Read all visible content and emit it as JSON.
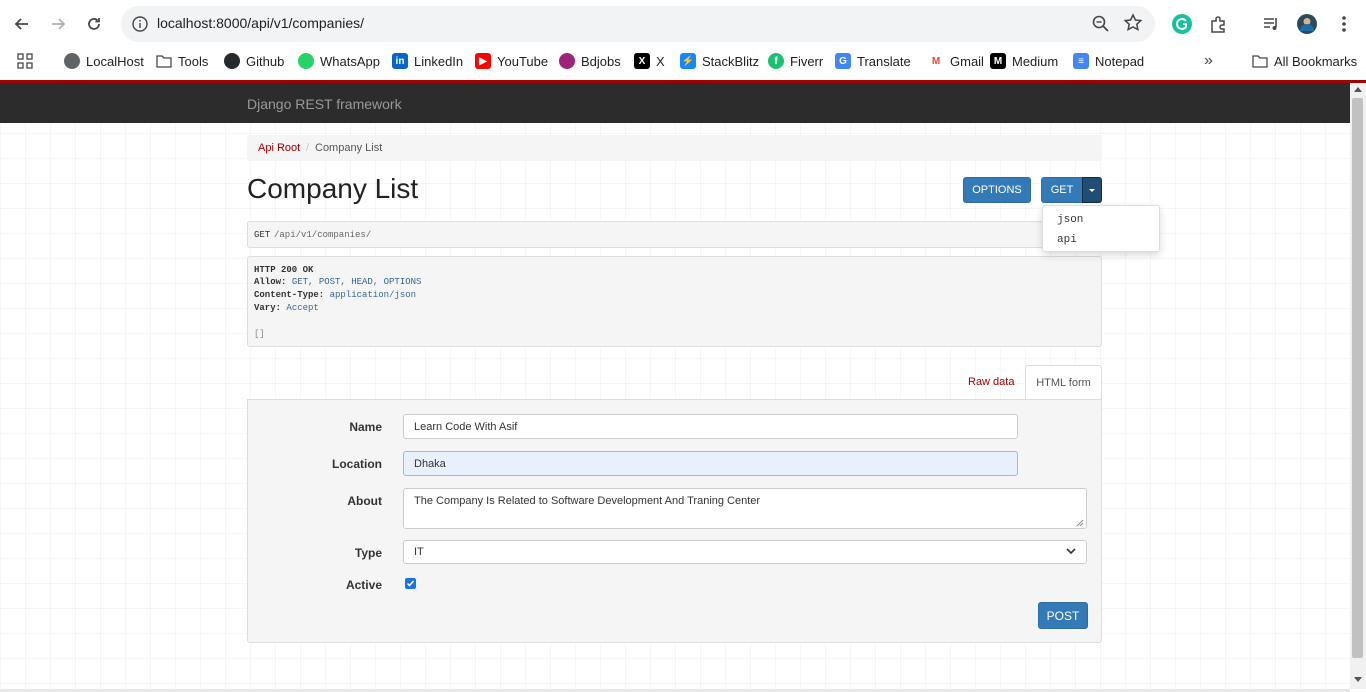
{
  "browser": {
    "url": "localhost:8000/api/v1/companies/",
    "bookmarks": [
      {
        "label": "LocalHost",
        "icon": "globe-icon"
      },
      {
        "label": "Tools",
        "icon": "folder-icon"
      },
      {
        "label": "Github",
        "icon": "github-icon"
      },
      {
        "label": "WhatsApp",
        "icon": "whatsapp-icon"
      },
      {
        "label": "LinkedIn",
        "icon": "linkedin-icon"
      },
      {
        "label": "YouTube",
        "icon": "youtube-icon"
      },
      {
        "label": "Bdjobs",
        "icon": "bdjobs-icon"
      },
      {
        "label": "X",
        "icon": "x-icon"
      },
      {
        "label": "StackBlitz",
        "icon": "stackblitz-icon"
      },
      {
        "label": "Fiverr",
        "icon": "fiverr-icon"
      },
      {
        "label": "Translate",
        "icon": "translate-icon"
      },
      {
        "label": "Gmail",
        "icon": "gmail-icon"
      },
      {
        "label": "Medium",
        "icon": "medium-icon"
      },
      {
        "label": "Notepad",
        "icon": "notepad-icon"
      }
    ],
    "all_bookmarks_label": "All Bookmarks"
  },
  "navbar": {
    "brand": "Django REST framework"
  },
  "breadcrumb": {
    "root": "Api Root",
    "separator": "/",
    "current": "Company List"
  },
  "page": {
    "title": "Company List"
  },
  "buttons": {
    "options": "OPTIONS",
    "get": "GET",
    "post": "POST"
  },
  "format_dropdown": {
    "items": [
      "json",
      "api"
    ]
  },
  "request": {
    "method": "GET",
    "path": "/api/v1/companies/"
  },
  "response": {
    "status": "HTTP 200 OK",
    "headers": [
      {
        "key": "Allow:",
        "value": "GET, POST, HEAD, OPTIONS"
      },
      {
        "key": "Content-Type:",
        "value": "application/json"
      },
      {
        "key": "Vary:",
        "value": "Accept"
      }
    ],
    "body": "[]"
  },
  "tabs": {
    "raw": "Raw data",
    "html": "HTML form"
  },
  "form": {
    "name_label": "Name",
    "name_value": "Learn Code With Asif",
    "location_label": "Location",
    "location_value": "Dhaka",
    "about_label": "About",
    "about_value": "The Company Is Related to Software Development And Traning Center",
    "type_label": "Type",
    "type_value": "IT",
    "active_label": "Active",
    "active_checked": true
  },
  "colors": {
    "accent": "#a30000",
    "primary": "#337ab7",
    "navbar": "#2c2c2c"
  }
}
